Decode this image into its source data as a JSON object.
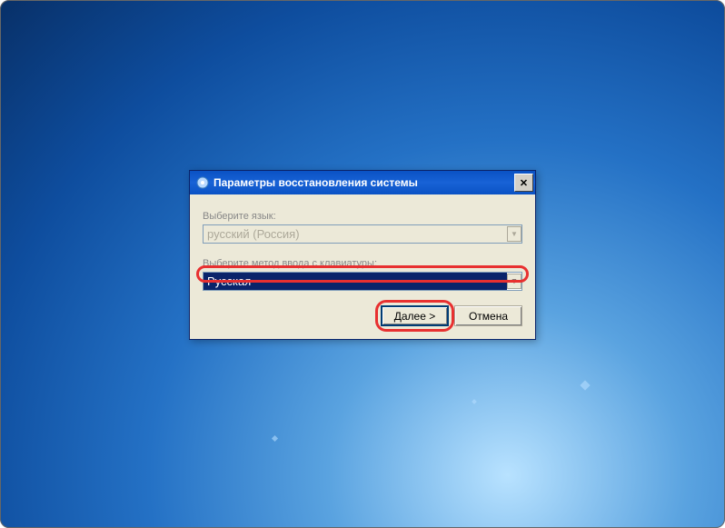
{
  "dialog": {
    "title": "Параметры восстановления системы",
    "label_language": "Выберите язык:",
    "language_value": "русский (Россия)",
    "label_keyboard": "Выберите метод ввода с клавиатуры:",
    "keyboard_value": "Русская",
    "next_button": "Далее >",
    "cancel_button": "Отмена",
    "close_symbol": "✕"
  }
}
